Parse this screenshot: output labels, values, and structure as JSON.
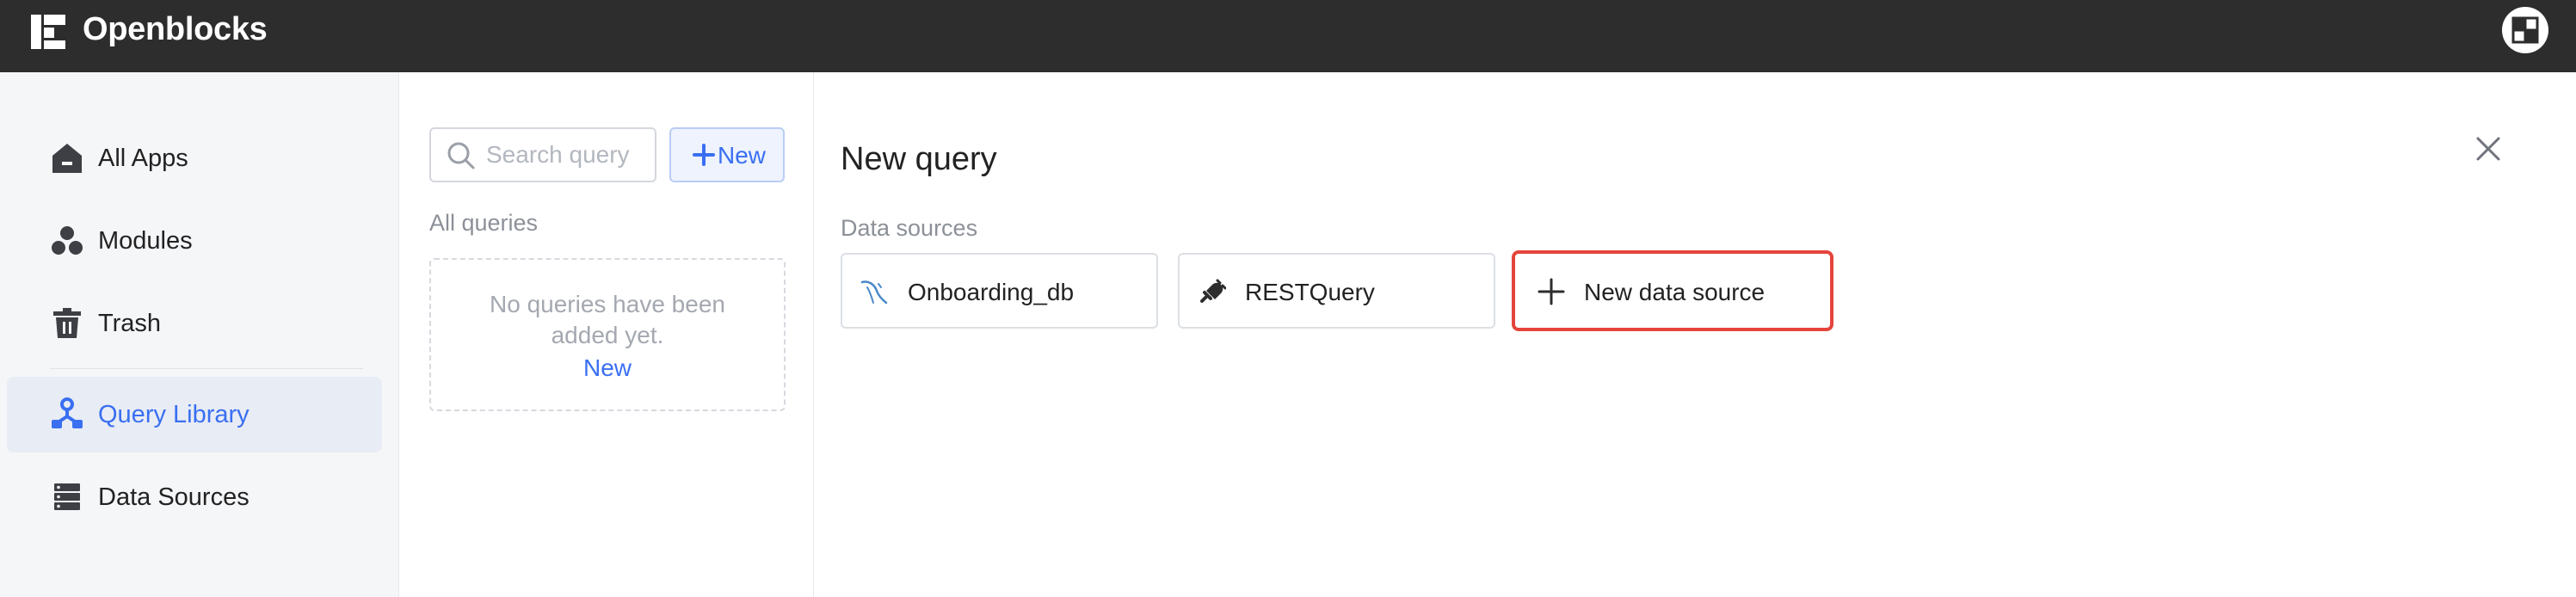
{
  "app": {
    "title": "Openblocks"
  },
  "sidebar": {
    "items": [
      {
        "label": "All Apps",
        "icon": "home-icon",
        "active": false
      },
      {
        "label": "Modules",
        "icon": "modules-icon",
        "active": false
      },
      {
        "label": "Trash",
        "icon": "trash-icon",
        "active": false
      },
      {
        "label": "Query Library",
        "icon": "query-library-icon",
        "active": true
      },
      {
        "label": "Data Sources",
        "icon": "database-icon",
        "active": false
      }
    ]
  },
  "queries": {
    "search_placeholder": "Search query",
    "new_button_label": "New",
    "section_label": "All queries",
    "empty_text": "No queries have been added yet.",
    "empty_link": "New"
  },
  "main": {
    "title": "New query",
    "data_sources_label": "Data sources",
    "data_sources": [
      {
        "label": "Onboarding_db",
        "icon": "mysql-icon"
      },
      {
        "label": "RESTQuery",
        "icon": "plug-icon"
      },
      {
        "label": "New data source",
        "icon": "plus-icon",
        "highlighted": true
      }
    ]
  },
  "colors": {
    "topbar": "#2d2d2d",
    "accent": "#3a6ff2",
    "highlight_border": "#e5443b",
    "sidebar_bg": "#f5f6f8",
    "active_item_bg": "#e8ecf4"
  }
}
